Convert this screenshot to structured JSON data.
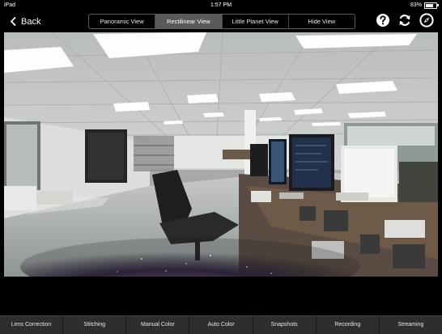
{
  "status_bar": {
    "carrier": "iPad",
    "time": "1:57 PM",
    "battery": "83%"
  },
  "nav": {
    "back_label": "Back",
    "views": [
      "Panoramic View",
      "Rectilinear View",
      "Little Planet View",
      "Hide View"
    ],
    "active_view": "Rectilinear View",
    "icons": [
      "help-icon",
      "refresh-icon",
      "compass-icon"
    ]
  },
  "toolbar": {
    "items": [
      "Lens Correction",
      "Stitching",
      "Manual Color",
      "Auto Color",
      "Snapshots",
      "Recording",
      "Streaming"
    ]
  },
  "colors": {
    "background": "#000000",
    "toolbar": "#2e2e2e",
    "segment_active": "#5a5a5a"
  }
}
